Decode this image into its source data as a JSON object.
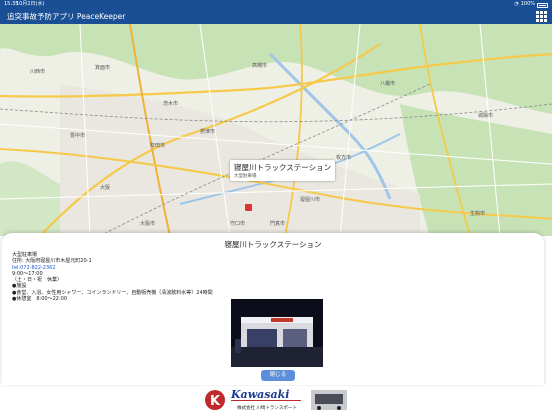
{
  "status_bar": {
    "time": "15:35",
    "date": "10月2日(水)",
    "right": "100%"
  },
  "header": {
    "title": "追突事故予防アプリ PeaceKeeper",
    "menu_icon": "grid-icon"
  },
  "map": {
    "labels": [
      "川西市",
      "箕面市",
      "高槻市",
      "八幡市",
      "城陽市",
      "茨木市",
      "豊中市",
      "吹田市",
      "摂津市",
      "寝屋川市",
      "枚方市",
      "門真市",
      "守口市",
      "大阪市",
      "生駒市",
      "大阪"
    ],
    "callout": {
      "title": "寝屋川トラックステーション",
      "subtitle": "大型駐車場"
    }
  },
  "modal": {
    "title": "寝屋川トラックステーション",
    "lines": [
      "大型駐車場",
      "住所: 大阪府寝屋川市木屋元町20-1",
      "tel:072-822-2362",
      "9:00〜17:00",
      "（土・日・祝　休業）",
      "●施設",
      "●食堂、入浴、女性用シャワー、コインランドリー、自動販売機（清涼飲料水等）24時間",
      "●休憩室　8:00〜22:00"
    ],
    "close_label": "閉じる"
  },
  "ad": {
    "brand": "Kawasaki",
    "company": "株式会社 川崎トランスポート"
  },
  "colors": {
    "header": "#1b4f95",
    "button": "#5b8fdb",
    "marker": "#dd3333"
  }
}
